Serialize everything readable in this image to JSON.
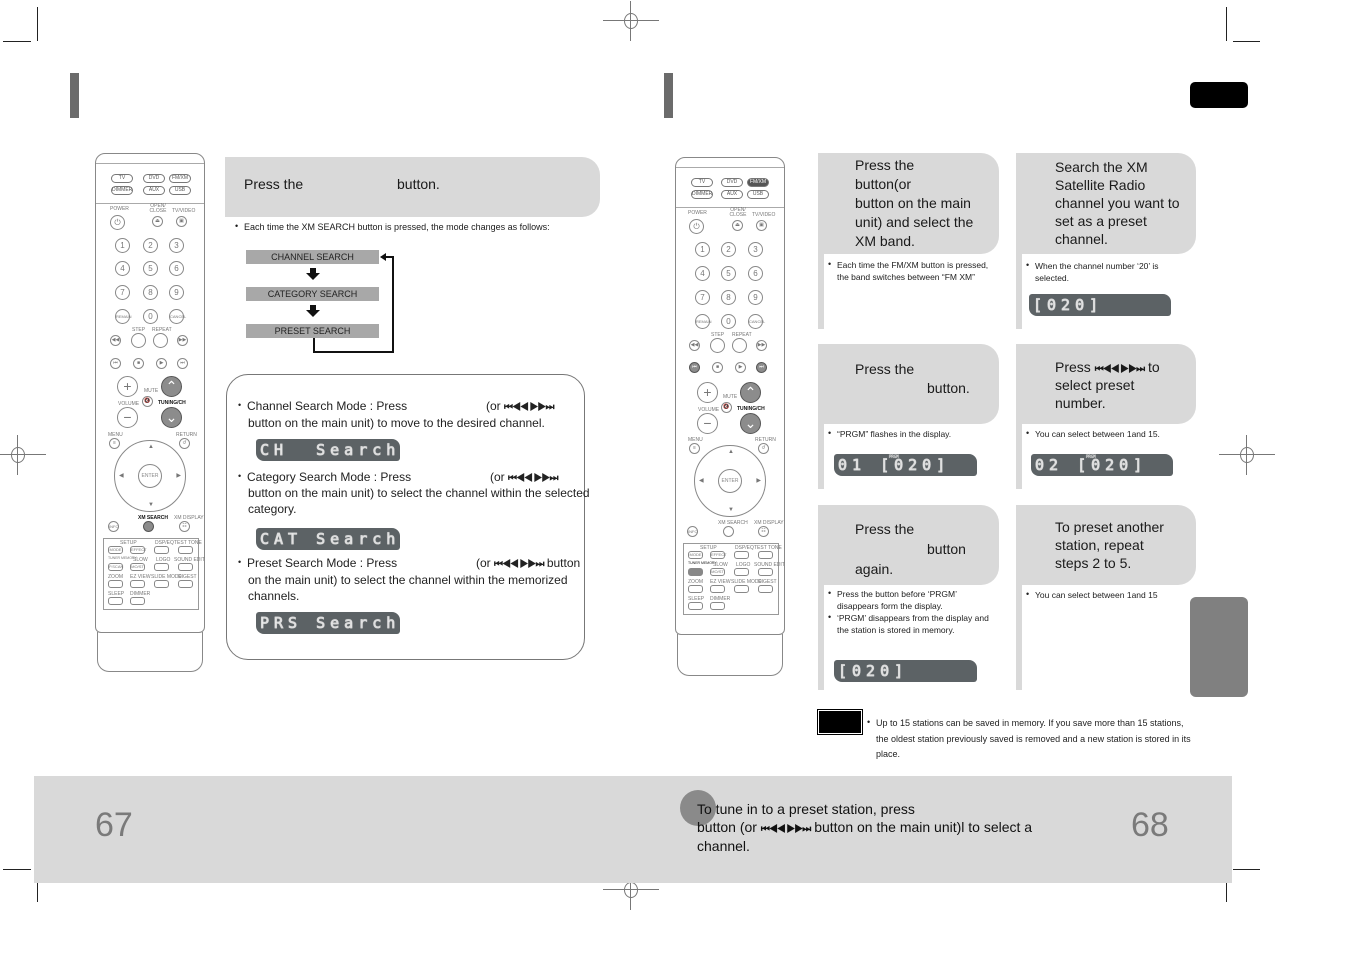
{
  "left_page": {
    "page_number": "67",
    "step1": {
      "instruction_prefix": "Press the",
      "instruction_suffix": "button.",
      "note": "Each time the XM SEARCH button is pressed, the mode changes as follows:",
      "flow": [
        "CHANNEL SEARCH",
        "CATEGORY SEARCH",
        "PRESET SEARCH"
      ]
    },
    "modes": [
      {
        "line1_prefix": "Channel Search Mode : Press",
        "line1_suffix": "(or",
        "line2": "button on the main unit) to move to the desired channel.",
        "display": "CH  Search"
      },
      {
        "line1_prefix": "Category Search Mode : Press",
        "line1_suffix": "(or",
        "line2": "button on the main unit) to select the channel within the selected",
        "line3": "category.",
        "display": "CAT Search"
      },
      {
        "line1_prefix": "Preset Search Mode : Press",
        "line1_suffix": "(or",
        "line1_end": "button",
        "line2": "on the main unit) to select the channel within the memorized",
        "line3": "channels.",
        "display": "PRS Search"
      }
    ],
    "skip_symbol": "⏮◀◀ ▶▶⏭"
  },
  "right_page": {
    "page_number": "68",
    "steps": [
      {
        "lines": [
          "Press the",
          "button(or",
          "button on the main",
          "unit) and select the",
          "XM band."
        ],
        "notes": [
          "Each time the FM/XM button is pressed, the band switches between “FM     XM”"
        ],
        "display": ""
      },
      {
        "lines": [
          "Search the XM",
          "Satellite Radio",
          "channel you want to",
          "set as a preset",
          "channel."
        ],
        "notes": [
          "When the channel number ‘20’ is selected."
        ],
        "display": "[020]"
      },
      {
        "lines": [
          "Press the",
          "button."
        ],
        "notes": [
          "“PRGM” flashes in the display."
        ],
        "display": "01 [020]",
        "display_indicator": "PRGM"
      },
      {
        "lines": [
          "Press",
          "to",
          "select preset",
          "number."
        ],
        "notes": [
          "You can select between 1and 15."
        ],
        "display": "02 [020]",
        "display_indicator": "PRGM"
      },
      {
        "lines": [
          "Press the",
          "button",
          "again."
        ],
        "notes": [
          "Press the                              button before ‘PRGM’ disappears form the display.",
          "‘PRGM’ disappears from the display and the station is stored in memory."
        ],
        "display": "[020]"
      },
      {
        "lines": [
          "To preset another",
          "station, repeat",
          "steps 2 to 5."
        ],
        "notes": [
          "You can select between 1and 15"
        ],
        "display": ""
      }
    ],
    "memory_note": "Up to 15 stations can be saved in memory. If you save more than 15 stations, the oldest station previously saved is removed and a new station is stored in its place.",
    "tip": {
      "line1": "To tune in to a preset station, press",
      "line2_prefix": "button (or",
      "line2_suffix": "button on the main unit)l to select a",
      "line3": "channel."
    }
  },
  "remote": {
    "sources": [
      "TV",
      "DVD",
      "FM/XM",
      "DIMMER",
      "AUX",
      "USB"
    ],
    "labels": {
      "power": "POWER",
      "open_close": "OPEN/ CLOSE",
      "tv_video": "TV/VIDEO",
      "step": "STEP",
      "repeat": "REPEAT",
      "volume": "VOLUME",
      "mute": "MUTE",
      "tuning": "TUNING/CH",
      "menu": "MENU",
      "return": "RETURN",
      "enter": "ENTER",
      "info": "INFO",
      "xm_search": "XM SEARCH",
      "xm_display": "XM DISPLAY",
      "setup": "SETUP",
      "mode": "MODE",
      "effect": "EFFECT",
      "dsp_eq": "DSP/EQ",
      "test_tone": "TEST TONE",
      "tuner_memory": "TUNER MEMORY",
      "p_scan": "P.SCAN",
      "slow": "SLOW",
      "mo_st": "MO/ST",
      "logo": "LOGO",
      "sound_edit": "SOUND EDIT",
      "zoom": "ZOOM",
      "ez_view": "EZ VIEW",
      "slide_mode": "SLIDE MODE",
      "digest": "DIGEST",
      "sleep": "SLEEP",
      "dimmer": "DIMMER",
      "remain": "REMAIN",
      "cancel": "CANCEL"
    },
    "digits": [
      "1",
      "2",
      "3",
      "4",
      "5",
      "6",
      "7",
      "8",
      "9",
      "0"
    ]
  }
}
